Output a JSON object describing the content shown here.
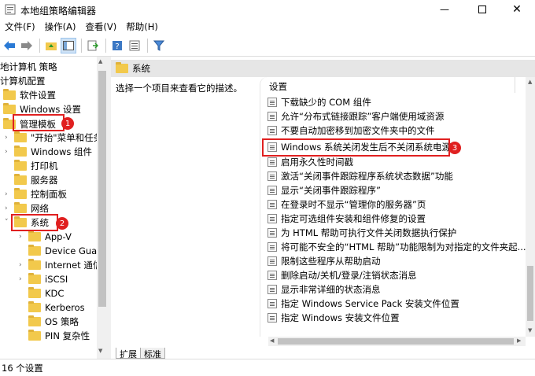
{
  "window": {
    "title": "本地组策略编辑器"
  },
  "menu": [
    "文件(F)",
    "操作(A)",
    "查看(V)",
    "帮助(H)"
  ],
  "tree": {
    "items": [
      {
        "label": "地计算机 策略",
        "indent": 0,
        "arrow": "",
        "folder": false
      },
      {
        "label": "计算机配置",
        "indent": 0,
        "arrow": "",
        "folder": false
      },
      {
        "label": "软件设置",
        "indent": 0,
        "arrow": "",
        "folder": true
      },
      {
        "label": "Windows 设置",
        "indent": 0,
        "arrow": "",
        "folder": true
      },
      {
        "label": "管理模板",
        "indent": 0,
        "arrow": "",
        "folder": true
      },
      {
        "label": "\"开始\"菜单和任务",
        "indent": 1,
        "arrow": "›",
        "folder": true
      },
      {
        "label": "Windows 组件",
        "indent": 1,
        "arrow": "›",
        "folder": true
      },
      {
        "label": "打印机",
        "indent": 1,
        "arrow": "",
        "folder": true
      },
      {
        "label": "服务器",
        "indent": 1,
        "arrow": "",
        "folder": true
      },
      {
        "label": "控制面板",
        "indent": 1,
        "arrow": "›",
        "folder": true
      },
      {
        "label": "网络",
        "indent": 1,
        "arrow": "›",
        "folder": true
      },
      {
        "label": "系统",
        "indent": 1,
        "arrow": "˅",
        "folder": true
      },
      {
        "label": "App-V",
        "indent": 2,
        "arrow": "›",
        "folder": true
      },
      {
        "label": "Device Guard",
        "indent": 2,
        "arrow": "",
        "folder": true
      },
      {
        "label": "Internet 通信",
        "indent": 2,
        "arrow": "›",
        "folder": true
      },
      {
        "label": "iSCSI",
        "indent": 2,
        "arrow": "›",
        "folder": true
      },
      {
        "label": "KDC",
        "indent": 2,
        "arrow": "",
        "folder": true
      },
      {
        "label": "Kerberos",
        "indent": 2,
        "arrow": "",
        "folder": true
      },
      {
        "label": "OS 策略",
        "indent": 2,
        "arrow": "",
        "folder": true
      },
      {
        "label": "PIN 复杂性",
        "indent": 2,
        "arrow": "",
        "folder": true
      }
    ]
  },
  "header": {
    "title": "系统"
  },
  "description": "选择一个项目来查看它的描述。",
  "list": {
    "column": "设置",
    "items": [
      "下载缺少的 COM 组件",
      "允许“分布式链接跟踪”客户端使用域资源",
      "不要自动加密移到加密文件夹中的文件",
      "Windows 系统关闭发生后不关闭系统电源。",
      "启用永久性时间戳",
      "激活“关闭事件跟踪程序系统状态数据”功能",
      "显示“关闭事件跟踪程序”",
      "在登录时不显示“管理你的服务器”页",
      "指定可选组件安装和组件修复的设置",
      "为 HTML 帮助可执行文件关闭数据执行保护",
      "将可能不安全的“HTML 帮助”功能限制为对指定的文件夹起...",
      "限制这些程序从帮助启动",
      "删除启动/关机/登录/注销状态消息",
      "显示非常详细的状态消息",
      "指定 Windows Service Pack 安装文件位置",
      "指定 Windows 安装文件位置"
    ]
  },
  "tabs": [
    "扩展",
    "标准"
  ],
  "status": "16 个设置",
  "badges": [
    "1",
    "2",
    "3"
  ],
  "colors": {
    "annotation": "#e02020",
    "folder": "#f2c94c"
  }
}
